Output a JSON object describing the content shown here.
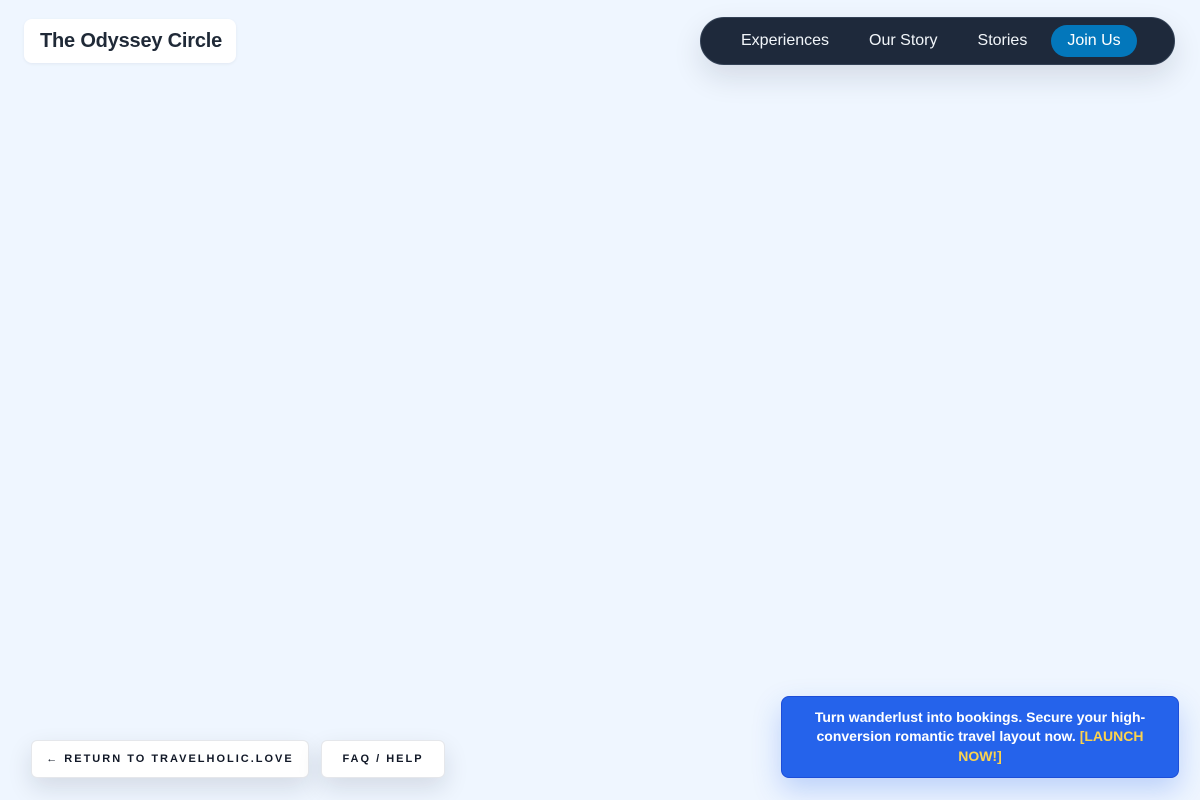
{
  "header": {
    "brand": "The Odyssey Circle",
    "nav": {
      "items": [
        {
          "label": "Experiences"
        },
        {
          "label": "Our Story"
        },
        {
          "label": "Stories"
        }
      ],
      "cta_label": "Join Us"
    }
  },
  "footer": {
    "return_label": "← RETURN TO TRAVELHOLIC.LOVE",
    "faq_label": "FAQ / HELP"
  },
  "promo": {
    "text": "Turn wanderlust into bookings. Secure your high-conversion romantic travel layout now.",
    "link_label": "[LAUNCH NOW!]"
  },
  "colors": {
    "page_background": "#eff6ff",
    "nav_background": "#1e293b",
    "cta_background": "#0377bb",
    "promo_background": "#2563eb",
    "promo_link": "#fcd34d"
  }
}
